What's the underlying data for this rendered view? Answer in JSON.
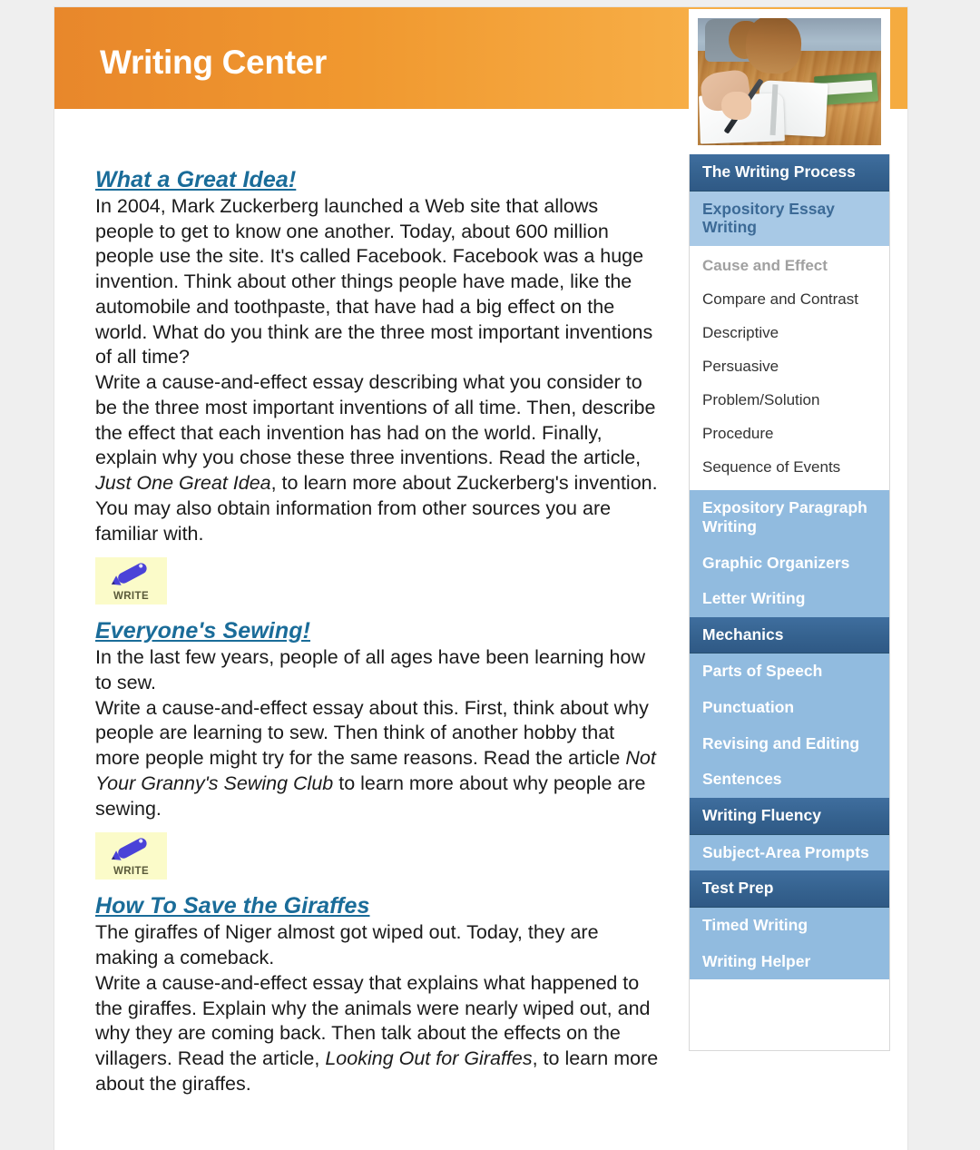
{
  "header": {
    "title": "Writing Center"
  },
  "photo": {
    "alt": "student-writing-in-notebook-photo"
  },
  "sidebar": {
    "sections": [
      {
        "label": "The Writing Process",
        "style": "dark",
        "items": []
      },
      {
        "label": "Expository Essay Writing",
        "style": "active",
        "items": [
          {
            "label": "Cause and Effect",
            "current": true
          },
          {
            "label": "Compare and Contrast",
            "current": false
          },
          {
            "label": "Descriptive",
            "current": false
          },
          {
            "label": "Persuasive",
            "current": false
          },
          {
            "label": "Problem/Solution",
            "current": false
          },
          {
            "label": "Procedure",
            "current": false
          },
          {
            "label": "Sequence of Events",
            "current": false
          }
        ]
      },
      {
        "label": "Expository Paragraph Writing",
        "style": "light",
        "items": []
      },
      {
        "label": "Graphic Organizers",
        "style": "light",
        "items": []
      },
      {
        "label": "Letter Writing",
        "style": "light",
        "items": []
      },
      {
        "label": "Mechanics",
        "style": "dark",
        "items": []
      },
      {
        "label": "Parts of Speech",
        "style": "light",
        "items": []
      },
      {
        "label": "Punctuation",
        "style": "light",
        "items": []
      },
      {
        "label": "Revising and Editing",
        "style": "light",
        "items": []
      },
      {
        "label": "Sentences",
        "style": "light",
        "items": []
      },
      {
        "label": "Writing Fluency",
        "style": "dark",
        "items": []
      },
      {
        "label": "Subject-Area Prompts",
        "style": "light",
        "items": []
      },
      {
        "label": "Test Prep",
        "style": "dark",
        "items": []
      },
      {
        "label": "Timed Writing",
        "style": "light",
        "items": []
      },
      {
        "label": "Writing Helper",
        "style": "light",
        "items": []
      }
    ]
  },
  "main": {
    "articles": [
      {
        "title": "What a Great Idea!",
        "intro": "In 2004, Mark Zuckerberg launched a Web site that allows people to get to know one another. Today, about 600 million people use the site. It's called Facebook. Facebook was a huge invention. Think about other things people have made, like the automobile and toothpaste, that have had a big effect on the world. What do you think are the three most important inventions of all time?",
        "prompt_before": "Write a cause-and-effect essay describing what you consider to be the three most important inventions of all time. Then, describe the effect that each invention has had on the world. Finally, explain why you chose these three inventions. Read the article, ",
        "prompt_italic": "Just One Great Idea",
        "prompt_after": ", to learn more about Zuckerberg's invention. You may also obtain information from other sources you are familiar with.",
        "write_label": "WRITE"
      },
      {
        "title": "Everyone's Sewing!",
        "intro": "In the last few years, people of all ages have been learning how to sew.",
        "prompt_before": "Write a cause-and-effect essay about this. First, think about why people are learning to sew. Then think of another hobby that more people might try for the same reasons. Read the article ",
        "prompt_italic": "Not Your Granny's Sewing Club",
        "prompt_after": " to learn more about why people are sewing.",
        "write_label": "WRITE"
      },
      {
        "title": "How To Save the Giraffes",
        "intro": "The giraffes of Niger almost got wiped out. Today, they are making a comeback.",
        "prompt_before": "Write a cause-and-effect essay that explains what happened to the giraffes. Explain why the animals were nearly wiped out, and why they are coming back. Then talk about the effects on the villagers. Read the article, ",
        "prompt_italic": "Looking Out for Giraffes",
        "prompt_after": ", to learn more about the giraffes.",
        "write_label": ""
      }
    ]
  },
  "colors": {
    "header_orange_left": "#e8872b",
    "header_orange_right": "#f5ab3f",
    "nav_dark_blue": "#35628f",
    "nav_light_blue": "#91bbdf",
    "nav_active_blue": "#a8c9e6",
    "link_teal": "#1a6c99",
    "write_button_yellow": "#fbfbc9",
    "pencil_blue": "#4a42d8",
    "page_background": "#efefef"
  }
}
